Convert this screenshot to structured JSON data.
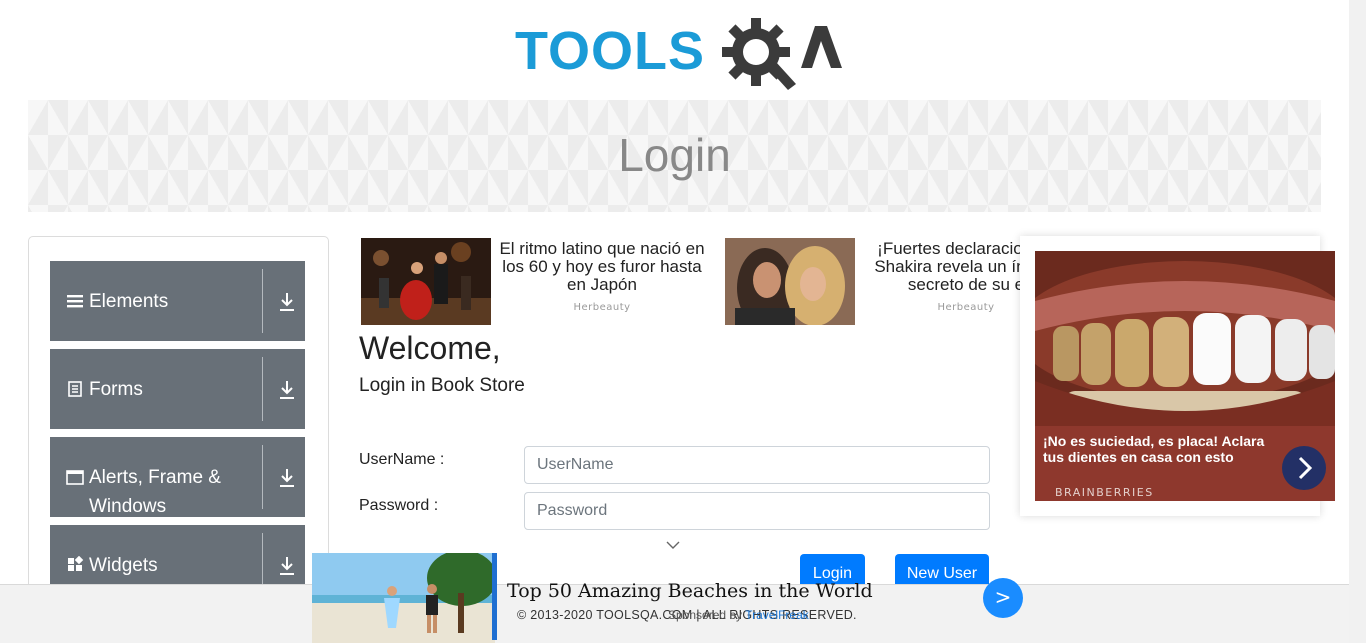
{
  "header": {
    "logo_left": "TOOLS",
    "logo_right": "QA"
  },
  "page_title": "Login",
  "sidebar": {
    "groups": [
      {
        "label": "Elements",
        "icon": "hamburger-icon"
      },
      {
        "label": "Forms",
        "icon": "document-icon"
      },
      {
        "label": "Alerts, Frame & Windows",
        "icon": "window-icon"
      },
      {
        "label": "Widgets",
        "icon": "widgets-icon"
      }
    ]
  },
  "ads_top": [
    {
      "text": "El ritmo latino que nació en los 60 y hoy es furor hasta en Japón",
      "source": "Herbeauty"
    },
    {
      "text": "¡Fuertes declaraciones! Shakira revela un íntimo secreto de su e",
      "source": "Herbeauty"
    }
  ],
  "main": {
    "welcome": "Welcome,",
    "subtitle": "Login in Book Store",
    "username_label": "UserName :",
    "username_placeholder": "UserName",
    "password_label": "Password :",
    "password_placeholder": "Password",
    "login_button": "Login",
    "new_user_button": "New User"
  },
  "side_ad": {
    "caption": "¡No es suciedad, es placa! Aclara tus dientes en casa con esto",
    "brand": "BRAINBERRIES"
  },
  "bottom_ad": {
    "title": "Top 50 Amazing Beaches in the World",
    "sponsored_prefix": "Sponsored by",
    "sponsor": "TravelFreak",
    "arrow": ">"
  },
  "footer": {
    "copyright": "© 2013-2020 TOOLSQA.COM | ALL RIGHTS RESERVED."
  }
}
